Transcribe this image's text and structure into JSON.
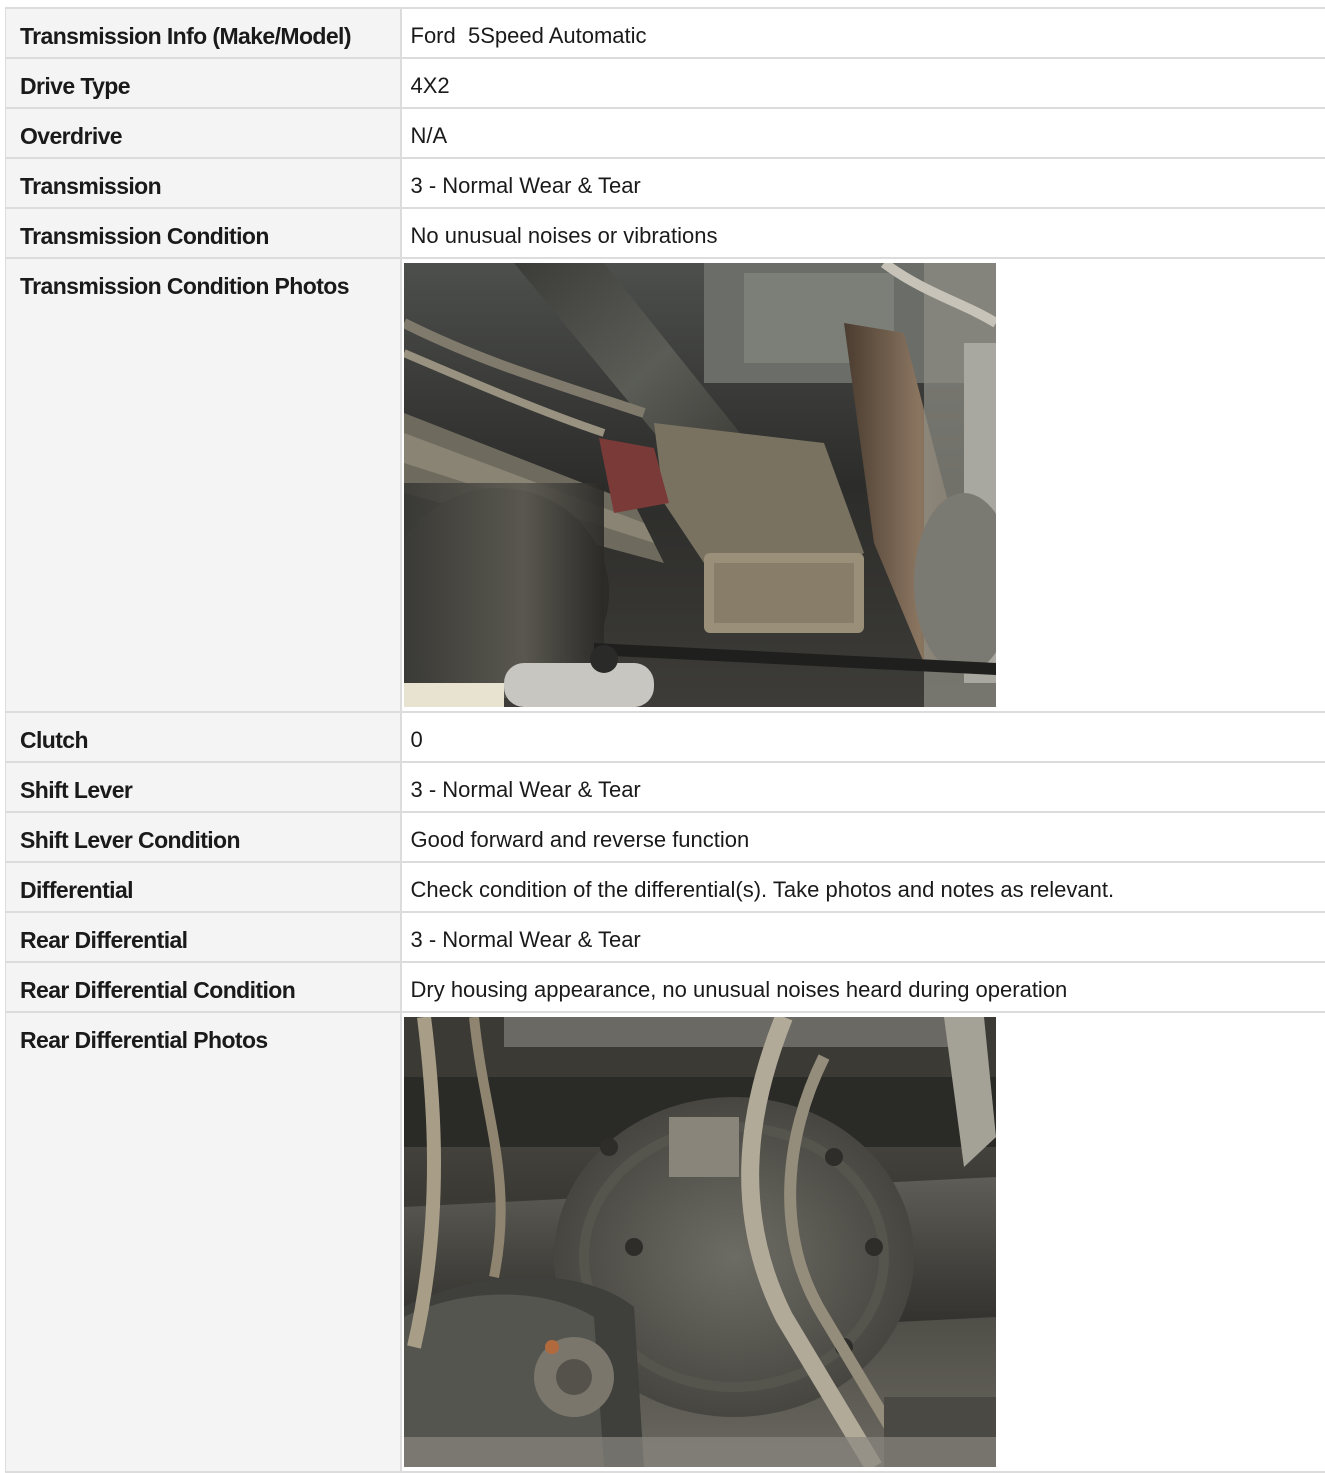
{
  "rows": [
    {
      "label": "Transmission Info (Make/Model)",
      "value": "Ford  5Speed Automatic"
    },
    {
      "label": "Drive Type",
      "value": "4X2"
    },
    {
      "label": "Overdrive",
      "value": "N/A"
    },
    {
      "label": "Transmission",
      "value": "3 - Normal Wear & Tear"
    },
    {
      "label": "Transmission Condition",
      "value": "No unusual noises or vibrations"
    },
    {
      "label": "Transmission Condition Photos",
      "photo": "transmission-underside-photo"
    },
    {
      "label": "Clutch",
      "value": "0"
    },
    {
      "label": "Shift Lever",
      "value": "3 - Normal Wear & Tear"
    },
    {
      "label": "Shift Lever Condition",
      "value": "Good forward and reverse function"
    },
    {
      "label": "Differential",
      "value": "Check condition of the differential(s). Take photos and notes as relevant."
    },
    {
      "label": "Rear Differential",
      "value": "3 - Normal Wear & Tear"
    },
    {
      "label": "Rear Differential Condition",
      "value": "Dry housing appearance, no unusual noises heard during operation"
    },
    {
      "label": "Rear Differential Photos",
      "photo": "rear-differential-photo"
    }
  ]
}
